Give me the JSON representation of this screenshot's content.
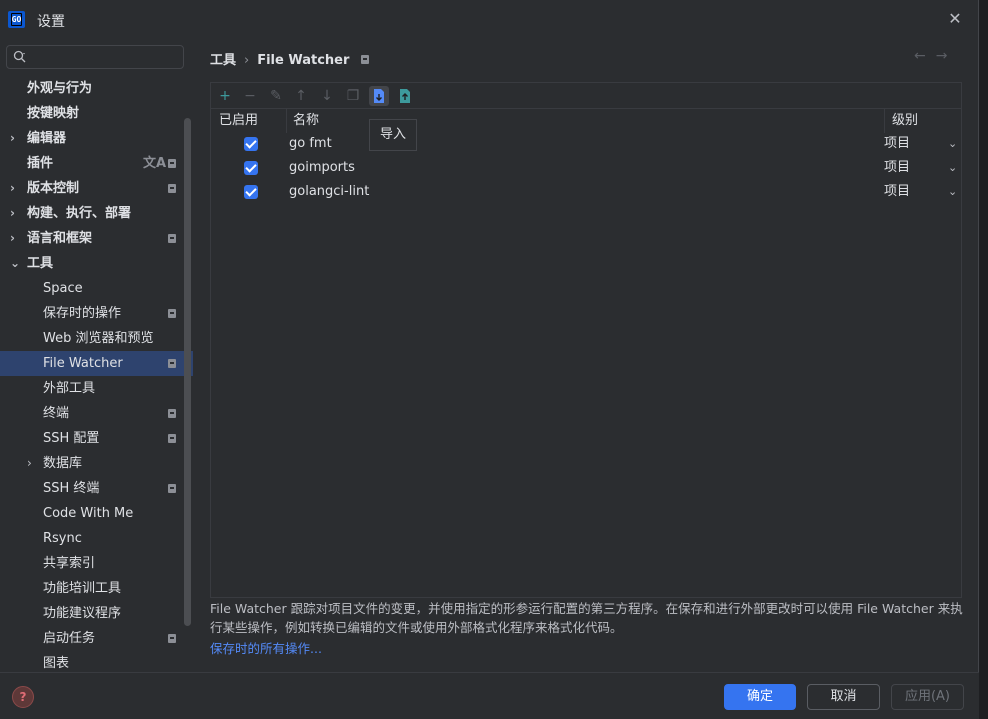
{
  "window": {
    "title": "设置",
    "close": "✕"
  },
  "search": {
    "placeholder": "",
    "value": ""
  },
  "sidebar": {
    "items": [
      {
        "label": "外观与行为",
        "bold": true,
        "chevron": "",
        "pin": false
      },
      {
        "label": "按键映射",
        "bold": true,
        "chevron": "",
        "pin": false
      },
      {
        "label": "编辑器",
        "bold": true,
        "chevron": "›",
        "pin": false
      },
      {
        "label": "插件",
        "bold": true,
        "chevron": "",
        "pin": true,
        "translate": "文A"
      },
      {
        "label": "版本控制",
        "bold": true,
        "chevron": "›",
        "pin": true
      },
      {
        "label": "构建、执行、部署",
        "bold": true,
        "chevron": "›",
        "pin": false
      },
      {
        "label": "语言和框架",
        "bold": true,
        "chevron": "›",
        "pin": true
      },
      {
        "label": "工具",
        "bold": true,
        "chevron": "⌄",
        "pin": false
      },
      {
        "label": "Space",
        "bold": false,
        "chevron": "",
        "pin": false
      },
      {
        "label": "保存时的操作",
        "bold": false,
        "chevron": "",
        "pin": true
      },
      {
        "label": "Web 浏览器和预览",
        "bold": false,
        "chevron": "",
        "pin": false
      },
      {
        "label": "File Watcher",
        "bold": false,
        "chevron": "",
        "pin": true,
        "selected": true
      },
      {
        "label": "外部工具",
        "bold": false,
        "chevron": "",
        "pin": false
      },
      {
        "label": "终端",
        "bold": false,
        "chevron": "",
        "pin": true
      },
      {
        "label": "SSH 配置",
        "bold": false,
        "chevron": "",
        "pin": true
      },
      {
        "label": "数据库",
        "bold": false,
        "chevron": "›",
        "pin": false
      },
      {
        "label": "SSH 终端",
        "bold": false,
        "chevron": "",
        "pin": true
      },
      {
        "label": "Code With Me",
        "bold": false,
        "chevron": "",
        "pin": false
      },
      {
        "label": "Rsync",
        "bold": false,
        "chevron": "",
        "pin": false
      },
      {
        "label": "共享索引",
        "bold": false,
        "chevron": "",
        "pin": false
      },
      {
        "label": "功能培训工具",
        "bold": false,
        "chevron": "",
        "pin": false
      },
      {
        "label": "功能建议程序",
        "bold": false,
        "chevron": "",
        "pin": false
      },
      {
        "label": "启动任务",
        "bold": false,
        "chevron": "",
        "pin": true
      },
      {
        "label": "图表",
        "bold": false,
        "chevron": "",
        "pin": false
      }
    ]
  },
  "breadcrumb": {
    "parent": "工具",
    "separator": "›",
    "current": "File Watcher"
  },
  "toolbar": {
    "buttons": [
      {
        "name": "add",
        "glyph": "+"
      },
      {
        "name": "remove",
        "glyph": "−"
      },
      {
        "name": "edit",
        "glyph": "✎"
      },
      {
        "name": "move-up",
        "glyph": "↑"
      },
      {
        "name": "move-down",
        "glyph": "↓"
      },
      {
        "name": "copy",
        "glyph": "❐"
      },
      {
        "name": "import",
        "glyph": "⇩"
      },
      {
        "name": "export",
        "glyph": "⇧"
      }
    ],
    "tooltip": "导入"
  },
  "table": {
    "headers": {
      "enabled": "已启用",
      "name": "名称",
      "level": "级别"
    },
    "rows": [
      {
        "enabled": true,
        "name": "go fmt",
        "level": "项目"
      },
      {
        "enabled": true,
        "name": "goimports",
        "level": "项目"
      },
      {
        "enabled": true,
        "name": "golangci-lint",
        "level": "项目"
      }
    ]
  },
  "description": {
    "text": "File Watcher 跟踪对项目文件的变更，并使用指定的形参运行配置的第三方程序。在保存和进行外部更改时可以使用 File Watcher 来执行某些操作，例如转换已编辑的文件或使用外部格式化程序来格式化代码。",
    "link": "保存时的所有操作..."
  },
  "footer": {
    "help": "?",
    "ok": "确定",
    "cancel": "取消",
    "apply": "应用(A)"
  },
  "colors": {
    "accent": "#3574f0",
    "selection": "#2e436e",
    "background": "#2b2d30",
    "link": "#548af7"
  }
}
